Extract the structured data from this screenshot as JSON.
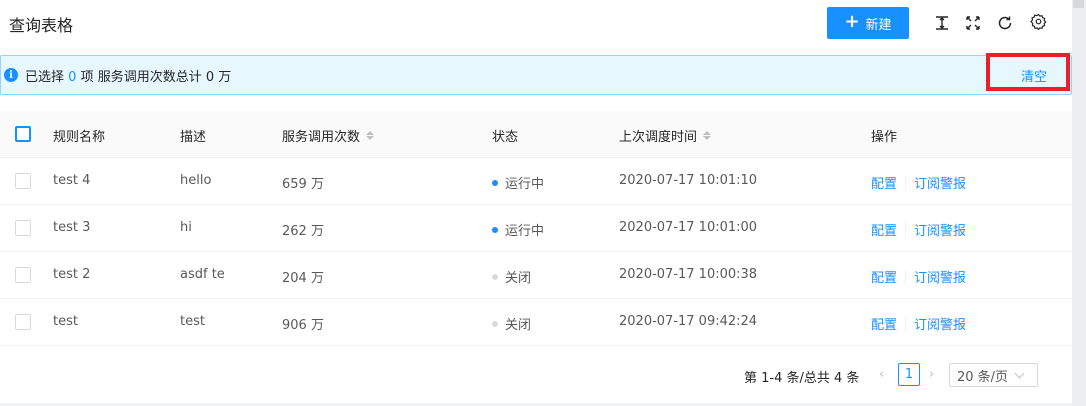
{
  "header": {
    "title": "查询表格",
    "new_button": {
      "icon": "plus-icon",
      "label": "新建"
    },
    "tools": [
      "column-height-icon",
      "fullscreen-icon",
      "reload-icon",
      "setting-icon"
    ]
  },
  "alert": {
    "prefix": "已选择",
    "selected_count": "0",
    "middle": "项 服务调用次数总计 0 万",
    "clear_label": "清空"
  },
  "table": {
    "columns": [
      "规则名称",
      "描述",
      "服务调用次数",
      "状态",
      "上次调度时间",
      "操作"
    ],
    "rows": [
      {
        "name": "test 4",
        "desc": "hello",
        "calls": "659 万",
        "status": "运行中",
        "status_kind": "running",
        "time": "2020-07-17 10:01:10"
      },
      {
        "name": "test 3",
        "desc": "hi",
        "calls": "262 万",
        "status": "运行中",
        "status_kind": "running",
        "time": "2020-07-17 10:01:00"
      },
      {
        "name": "test 2",
        "desc": "asdf te",
        "calls": "204 万",
        "status": "关闭",
        "status_kind": "closed",
        "time": "2020-07-17 10:00:38"
      },
      {
        "name": "test",
        "desc": "test",
        "calls": "906 万",
        "status": "关闭",
        "status_kind": "closed",
        "time": "2020-07-17 09:42:24"
      }
    ],
    "actions": {
      "config": "配置",
      "subscribe": "订阅警报"
    }
  },
  "pagination": {
    "total_text": "第 1-4 条/总共 4 条",
    "prev": "‹",
    "current_page": "1",
    "next": "›",
    "page_size": "20 条/页"
  },
  "colors": {
    "primary": "#1890ff",
    "highlight": "#e8202a",
    "alert_bg": "#e6f7ff"
  }
}
